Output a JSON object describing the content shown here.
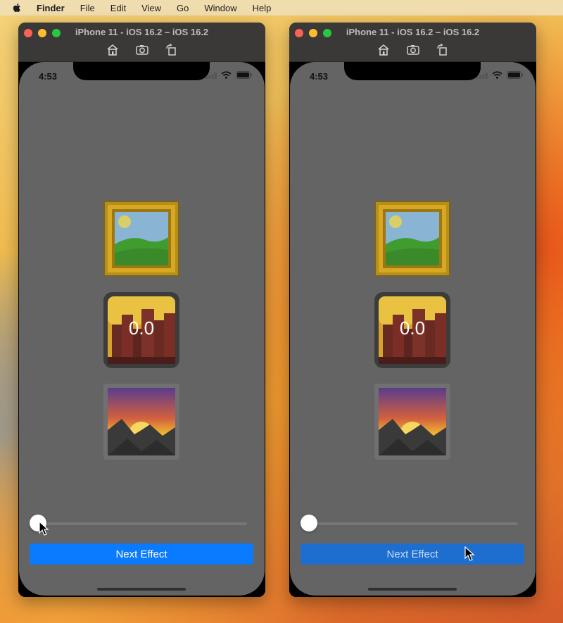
{
  "menubar": {
    "icon": "apple-icon",
    "items": [
      "Finder",
      "File",
      "Edit",
      "View",
      "Go",
      "Window",
      "Help"
    ]
  },
  "colors": {
    "screen_bg": "#646464",
    "button_active": "#0a7aff",
    "button_pressed": "#1e6ed0",
    "button_text_pressed": "#c8dbf5"
  },
  "simulators": [
    {
      "title": "iPhone 11 - iOS 16.2 – iOS 16.2",
      "toolbar_icons": [
        "home-icon",
        "screenshot-icon",
        "rotate-icon"
      ],
      "status_time": "4:53",
      "status_icons": [
        "cellular-icon",
        "wifi-icon",
        "battery-icon"
      ],
      "emoji_tiles": [
        "framed-picture-emoji",
        "cityscape-emoji",
        "sunset-emoji"
      ],
      "counter_value": "0.0",
      "slider_value": 0,
      "button_label": "Next Effect",
      "button_state": "active"
    },
    {
      "title": "iPhone 11 - iOS 16.2 – iOS 16.2",
      "toolbar_icons": [
        "home-icon",
        "screenshot-icon",
        "rotate-icon"
      ],
      "status_time": "4:53",
      "status_icons": [
        "cellular-icon",
        "wifi-icon",
        "battery-icon"
      ],
      "emoji_tiles": [
        "framed-picture-emoji",
        "cityscape-emoji",
        "sunset-emoji"
      ],
      "counter_value": "0.0",
      "slider_value": 0,
      "button_label": "Next Effect",
      "button_state": "pressed"
    }
  ]
}
